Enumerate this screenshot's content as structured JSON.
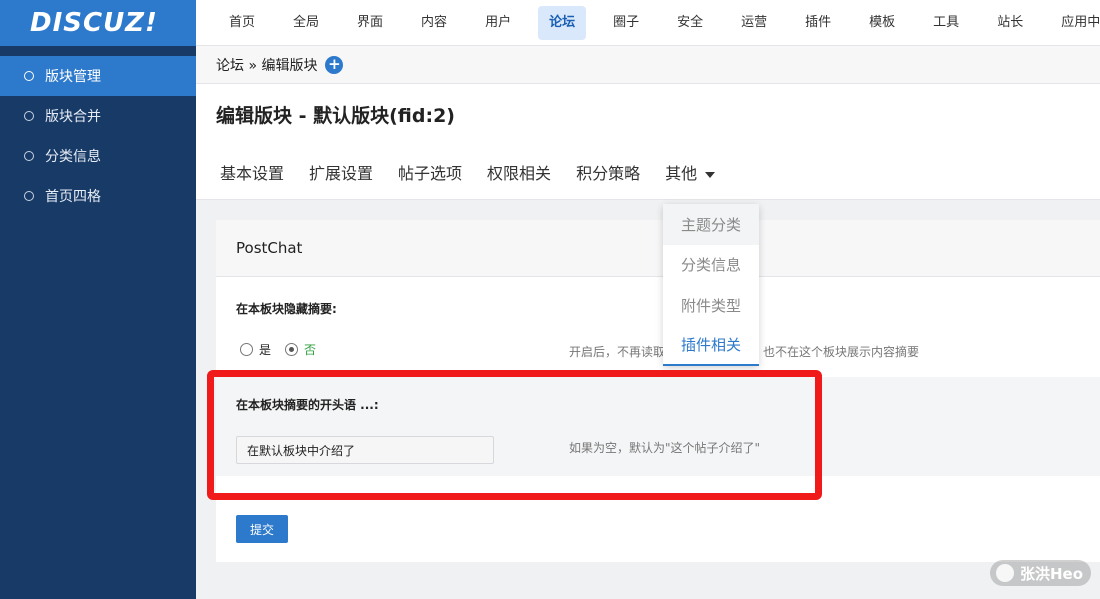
{
  "logo": {
    "text": "DISCUZ!"
  },
  "sidebar": {
    "items": [
      {
        "label": "版块管理",
        "active": true
      },
      {
        "label": "版块合并"
      },
      {
        "label": "分类信息"
      },
      {
        "label": "首页四格"
      }
    ]
  },
  "topnav": {
    "items": [
      "首页",
      "全局",
      "界面",
      "内容",
      "用户",
      "论坛",
      "圈子",
      "安全",
      "运营",
      "插件",
      "模板",
      "工具",
      "站长",
      "应用中心"
    ],
    "active": "论坛"
  },
  "breadcrumb": {
    "text": "论坛 » 编辑版块",
    "add_icon": "plus-circle-icon"
  },
  "page": {
    "title": "编辑版块 - 默认版块(fid:2)"
  },
  "tabs": [
    "基本设置",
    "扩展设置",
    "帖子选项",
    "权限相关",
    "积分策略",
    "其他"
  ],
  "dropdown": {
    "items": [
      "主题分类",
      "分类信息",
      "附件类型",
      "插件相关"
    ],
    "active": "插件相关"
  },
  "card": {
    "title": "PostChat",
    "field1": {
      "label": "在本板块隐藏摘要:",
      "options": [
        "是",
        "否"
      ],
      "selected": "否",
      "hint": "开启后，不再读取",
      "hint_tail": "也不在这个板块展示内容摘要"
    },
    "field2": {
      "label": "在本板块摘要的开头语 ...:",
      "value": "在默认板块中介绍了",
      "hint": "如果为空，默认为\"这个帖子介绍了\""
    },
    "submit_label": "提交"
  },
  "watermark": {
    "text": "张洪Heo"
  },
  "colors": {
    "accent": "#2d79cc",
    "sidebar_bg": "#183a66",
    "highlight": "#f01a1a",
    "selected_green": "#2e9e3e"
  }
}
